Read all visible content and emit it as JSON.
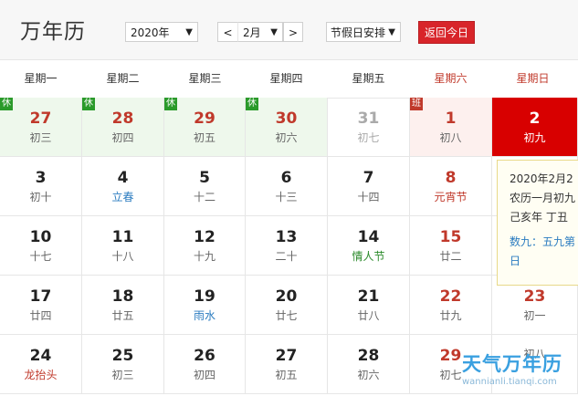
{
  "header": {
    "title": "万年历",
    "year_value": "2020年",
    "prev_label": "<",
    "month_value": "2月",
    "next_label": ">",
    "holiday_value": "节假日安排",
    "dropdown_arrow": "▼",
    "today_button": "返回今日"
  },
  "weekdays": [
    "星期一",
    "星期二",
    "星期三",
    "星期四",
    "星期五",
    "星期六",
    "星期日"
  ],
  "tags": {
    "rest": "休",
    "work": "班"
  },
  "weeks": [
    [
      {
        "day": "27",
        "lunar": "初三",
        "bg": "rest",
        "tag": "rest",
        "dayColor": "red"
      },
      {
        "day": "28",
        "lunar": "初四",
        "bg": "rest",
        "tag": "rest",
        "dayColor": "red"
      },
      {
        "day": "29",
        "lunar": "初五",
        "bg": "rest",
        "tag": "rest",
        "dayColor": "red"
      },
      {
        "day": "30",
        "lunar": "初六",
        "bg": "rest",
        "tag": "rest",
        "dayColor": "red"
      },
      {
        "day": "31",
        "lunar": "初七",
        "dayColor": "gray",
        "lunarColor": "gray"
      },
      {
        "day": "1",
        "lunar": "初八",
        "bg": "work",
        "tag": "work",
        "dayColor": "red"
      },
      {
        "day": "2",
        "lunar": "初九",
        "bg": "today"
      }
    ],
    [
      {
        "day": "3",
        "lunar": "初十"
      },
      {
        "day": "4",
        "lunar": "立春",
        "lunarColor": "blue"
      },
      {
        "day": "5",
        "lunar": "十二"
      },
      {
        "day": "6",
        "lunar": "十三"
      },
      {
        "day": "7",
        "lunar": "十四"
      },
      {
        "day": "8",
        "lunar": "元宵节",
        "dayColor": "red",
        "lunarColor": "redt"
      },
      {
        "day": "",
        "lunar": ""
      }
    ],
    [
      {
        "day": "10",
        "lunar": "十七"
      },
      {
        "day": "11",
        "lunar": "十八"
      },
      {
        "day": "12",
        "lunar": "十九"
      },
      {
        "day": "13",
        "lunar": "二十"
      },
      {
        "day": "14",
        "lunar": "情人节",
        "lunarColor": "green"
      },
      {
        "day": "15",
        "lunar": "廿二",
        "dayColor": "red"
      },
      {
        "day": "",
        "lunar": ""
      }
    ],
    [
      {
        "day": "17",
        "lunar": "廿四"
      },
      {
        "day": "18",
        "lunar": "廿五"
      },
      {
        "day": "19",
        "lunar": "雨水",
        "lunarColor": "blue"
      },
      {
        "day": "20",
        "lunar": "廿七"
      },
      {
        "day": "21",
        "lunar": "廿八"
      },
      {
        "day": "22",
        "lunar": "廿九",
        "dayColor": "red"
      },
      {
        "day": "23",
        "lunar": "初一",
        "dayColor": "red"
      }
    ],
    [
      {
        "day": "24",
        "lunar": "龙抬头",
        "lunarColor": "redt"
      },
      {
        "day": "25",
        "lunar": "初三"
      },
      {
        "day": "26",
        "lunar": "初四"
      },
      {
        "day": "27",
        "lunar": "初五"
      },
      {
        "day": "28",
        "lunar": "初六"
      },
      {
        "day": "29",
        "lunar": "初七",
        "dayColor": "red"
      },
      {
        "day": "",
        "lunar": "初八"
      }
    ]
  ],
  "popup": {
    "line1": "2020年2月2",
    "line2": "农历一月初九",
    "line3": "己亥年 丁丑",
    "line4": "数九：五九第",
    "line5": "日"
  },
  "watermark": {
    "title": "天气万年历",
    "url": "wannianli.tianqi.com"
  },
  "colors": {
    "today": "#d80000",
    "rest_bg": "#eef8ec",
    "work_bg": "#fdf0ee",
    "accent": "#d8252a"
  }
}
